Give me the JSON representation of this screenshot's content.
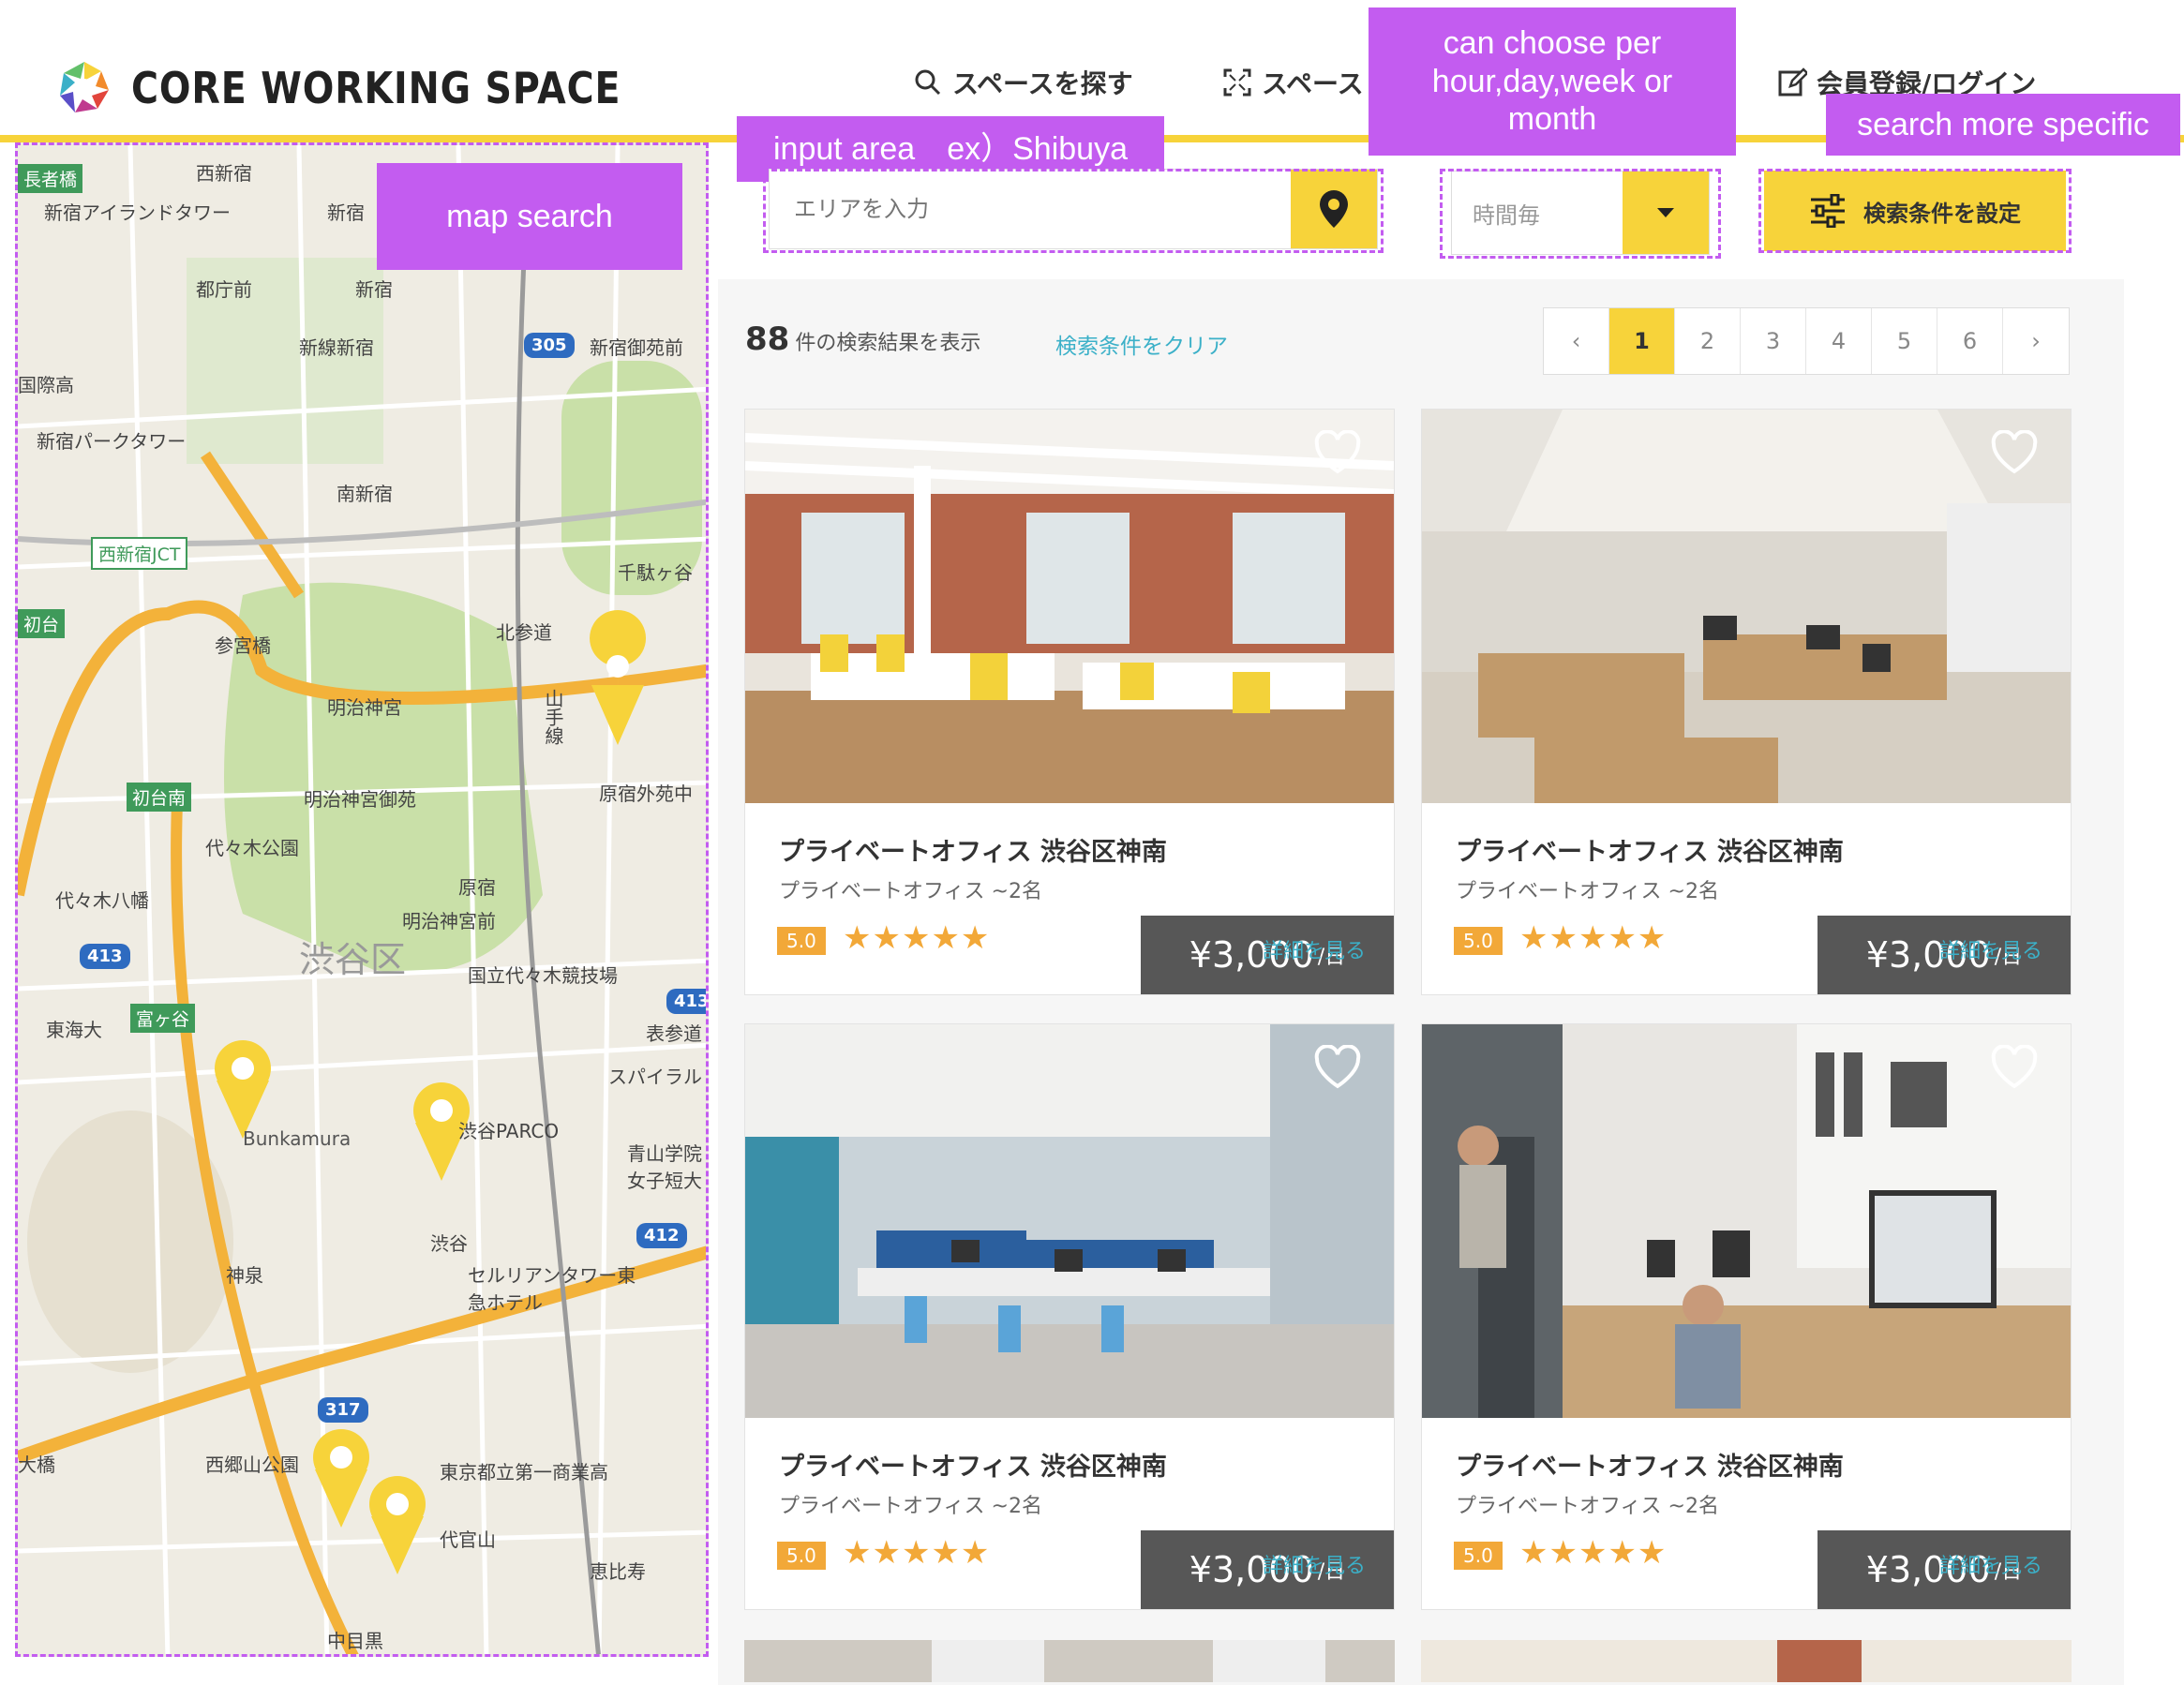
{
  "header": {
    "logo_text": "CORE WORKING SPACE",
    "nav_search": "スペースを探す",
    "nav_list": "スペース",
    "nav_login": "会員登録/ログイン"
  },
  "annotations": {
    "map": "map search",
    "input": "input area　ex）Shibuya",
    "period_line1": "can choose per",
    "period_line2": "hour,day,week or",
    "period_line3": "month",
    "filter": "search more specific"
  },
  "search": {
    "area_placeholder": "エリアを入力",
    "period_value": "時間毎",
    "filter_label": "検索条件を設定"
  },
  "results": {
    "count": "88",
    "count_suffix": "件の検索結果を表示",
    "clear_label": "検索条件をクリア",
    "pages": [
      "‹",
      "1",
      "2",
      "3",
      "4",
      "5",
      "6",
      "›"
    ],
    "current_page": "1"
  },
  "cards": [
    {
      "title": "プライベートオフィス 渋谷区神南",
      "subtitle": "プライベートオフィス ~2名",
      "rating": "5.0",
      "stars": "★★★★★",
      "price": "¥3,000",
      "unit": "/日",
      "details": "詳細を見る"
    },
    {
      "title": "プライベートオフィス 渋谷区神南",
      "subtitle": "プライベートオフィス ~2名",
      "rating": "5.0",
      "stars": "★★★★★",
      "price": "¥3,000",
      "unit": "/日",
      "details": "詳細を見る"
    },
    {
      "title": "プライベートオフィス 渋谷区神南",
      "subtitle": "プライベートオフィス ~2名",
      "rating": "5.0",
      "stars": "★★★★★",
      "price": "¥3,000",
      "unit": "/日",
      "details": "詳細を見る"
    },
    {
      "title": "プライベートオフィス 渋谷区神南",
      "subtitle": "プライベートオフィス ~2名",
      "rating": "5.0",
      "stars": "★★★★★",
      "price": "¥3,000",
      "unit": "/日",
      "details": "詳細を見る"
    }
  ],
  "map": {
    "labels": [
      "西新宿",
      "新宿アイランドタワー",
      "新宿",
      "都庁前",
      "新宿",
      "新宿御苑前",
      "新線新宿",
      "国際高",
      "新宿パークタワー",
      "南新宿",
      "西新宿JCT",
      "千駄ヶ谷",
      "参宮橋",
      "北参道",
      "明治神宮",
      "山手線",
      "明治神宮御苑",
      "原宿外苑中",
      "代々木公園",
      "原宿",
      "代々木八幡",
      "明治神宮前",
      "渋谷区",
      "国立代々木競技場",
      "東海大",
      "富ヶ谷",
      "表参道",
      "スパイラル",
      "Bunkamura",
      "渋谷PARCO",
      "青山学院女子短大",
      "渋谷",
      "神泉",
      "セルリアンタワー東急ホテル",
      "西郷山公園",
      "東京都立第一商業高",
      "代官山",
      "恵比寿",
      "中目黒",
      "長者橋",
      "初台",
      "初台南",
      "大橋"
    ],
    "shields": [
      "305",
      "413",
      "412",
      "317",
      "413"
    ]
  },
  "colors": {
    "accent": "#f7d33a",
    "annotation": "#c35cf0",
    "link": "#3bb0c8",
    "rating": "#f2a838"
  }
}
